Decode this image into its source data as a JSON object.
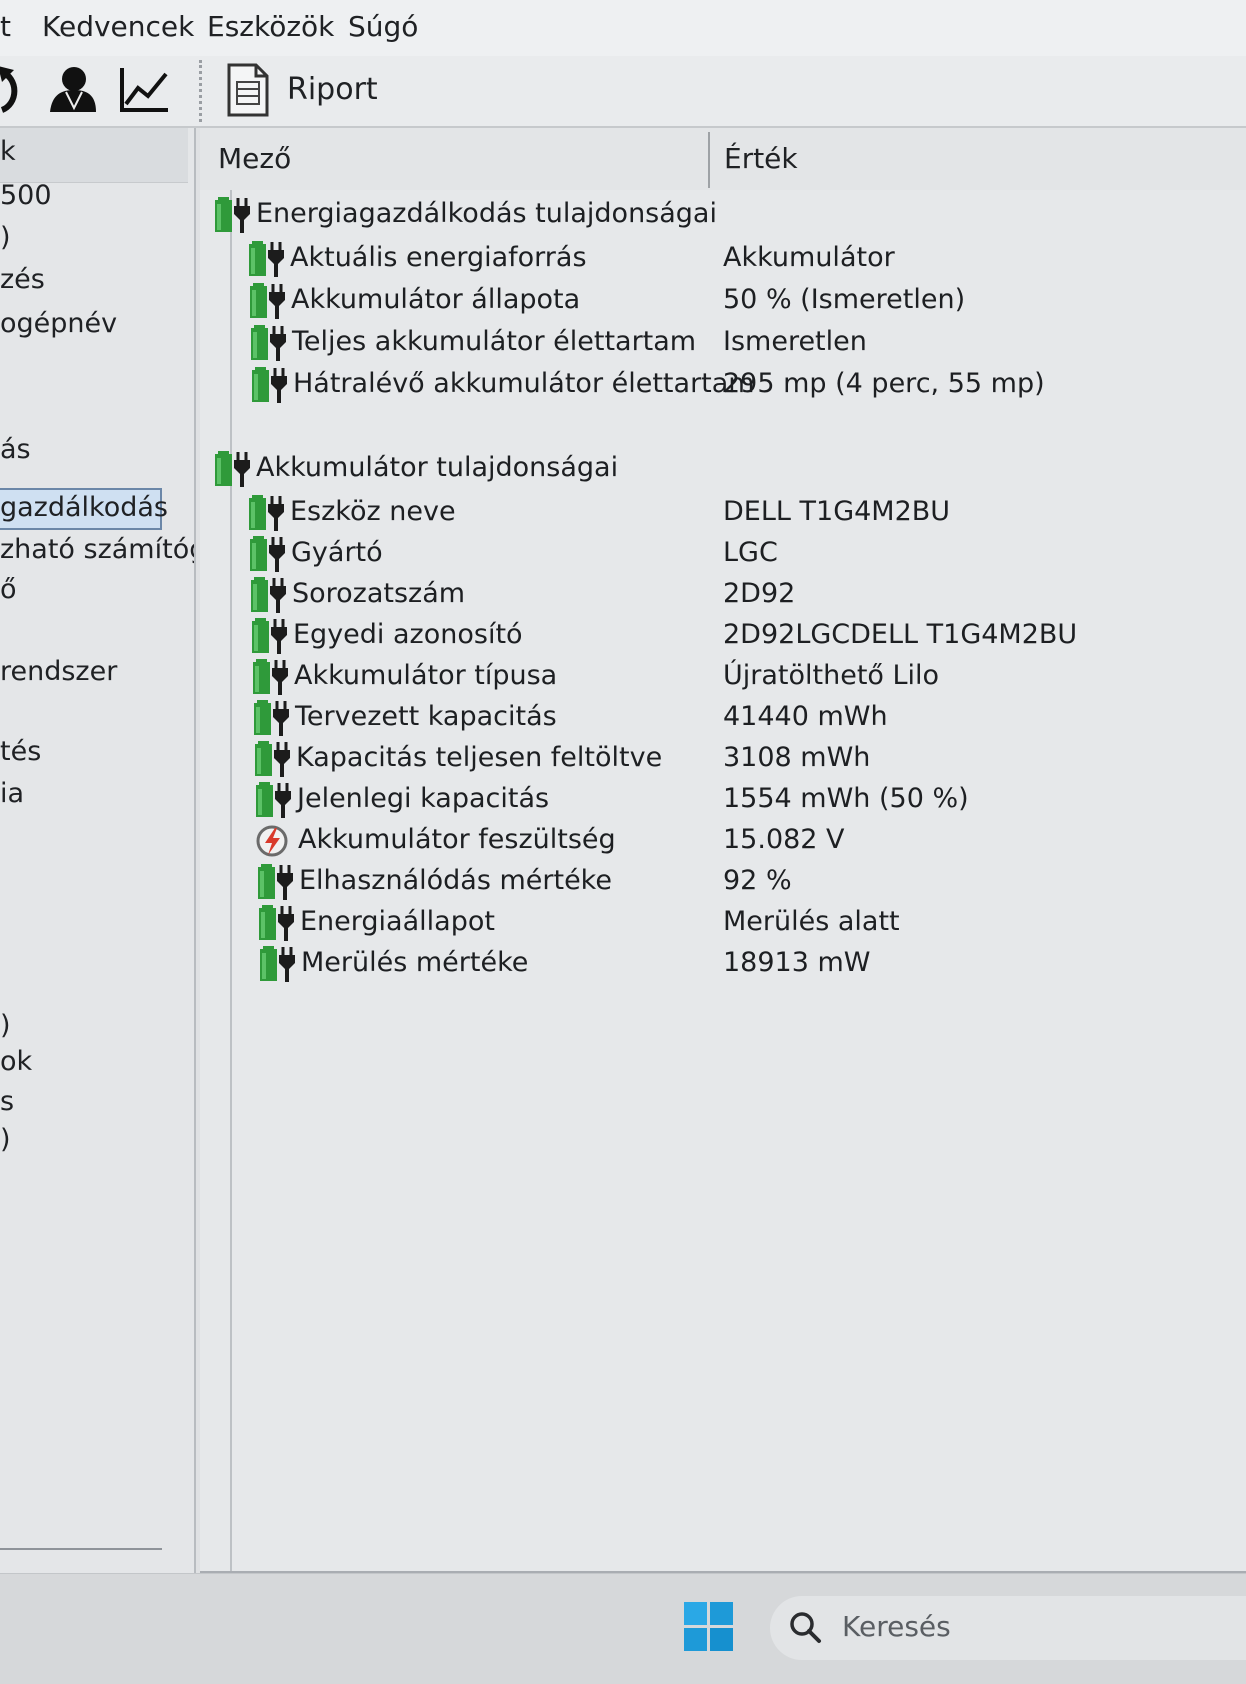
{
  "menubar": {
    "items": [
      {
        "label": "t"
      },
      {
        "label": "Kedvencek"
      },
      {
        "label": "Eszközök"
      },
      {
        "label": "Súgó"
      }
    ]
  },
  "toolbar": {
    "icons": [
      "refresh-icon",
      "user-icon",
      "chart-icon",
      "report-icon"
    ],
    "report_label": "Riport"
  },
  "left_tree": {
    "header": "k",
    "items": [
      "500",
      ")",
      "zés",
      "ogépnév",
      "ás",
      "gazdálkodás",
      "zható számítógé",
      "ő",
      " rendszer",
      "tés",
      "ia",
      ")",
      "ok",
      "s",
      ")"
    ],
    "selected": "gazdálkodás"
  },
  "list": {
    "columns": {
      "field": "Mező",
      "value": "Érték"
    },
    "sections": [
      {
        "title": "Energiagazdálkodás tulajdonságai",
        "rows": [
          {
            "field": "Aktuális energiaforrás",
            "value": "Akkumulátor",
            "icon": "battery-plug-icon"
          },
          {
            "field": "Akkumulátor állapota",
            "value": "50 % (Ismeretlen)",
            "icon": "battery-plug-icon"
          },
          {
            "field": "Teljes akkumulátor élettartam",
            "value": "Ismeretlen",
            "icon": "battery-plug-icon"
          },
          {
            "field": "Hátralévő akkumulátor élettartam",
            "value": "295 mp (4 perc, 55 mp)",
            "icon": "battery-plug-icon"
          }
        ]
      },
      {
        "title": "Akkumulátor tulajdonságai",
        "rows": [
          {
            "field": "Eszköz neve",
            "value": "DELL T1G4M2BU",
            "icon": "battery-plug-icon"
          },
          {
            "field": "Gyártó",
            "value": "LGC",
            "icon": "battery-plug-icon"
          },
          {
            "field": "Sorozatszám",
            "value": "2D92",
            "icon": "battery-plug-icon"
          },
          {
            "field": "Egyedi azonosító",
            "value": "2D92LGCDELL T1G4M2BU",
            "icon": "battery-plug-icon"
          },
          {
            "field": "Akkumulátor típusa",
            "value": "Újratölthető Lilo",
            "icon": "battery-plug-icon"
          },
          {
            "field": "Tervezett kapacitás",
            "value": "41440 mWh",
            "icon": "battery-plug-icon"
          },
          {
            "field": "Kapacitás teljesen feltöltve",
            "value": "3108 mWh",
            "icon": "battery-plug-icon"
          },
          {
            "field": "Jelenlegi kapacitás",
            "value": "1554 mWh  (50 %)",
            "icon": "battery-plug-icon"
          },
          {
            "field": "Akkumulátor feszültség",
            "value": "15.082 V",
            "icon": "voltage-icon"
          },
          {
            "field": "Elhasználódás mértéke",
            "value": "92 %",
            "icon": "battery-plug-icon"
          },
          {
            "field": "Energiaállapot",
            "value": "Merülés alatt",
            "icon": "battery-plug-icon"
          },
          {
            "field": "Merülés mértéke",
            "value": "18913 mW",
            "icon": "battery-plug-icon"
          }
        ]
      }
    ]
  },
  "taskbar": {
    "search_placeholder": "Keresés",
    "start_icon": "windows-start-icon",
    "search_icon": "search-icon"
  },
  "colors": {
    "battery_green": "#2f9a3a",
    "plug_dark": "#1c1c1c",
    "start_blue": "#1e9ad8"
  }
}
